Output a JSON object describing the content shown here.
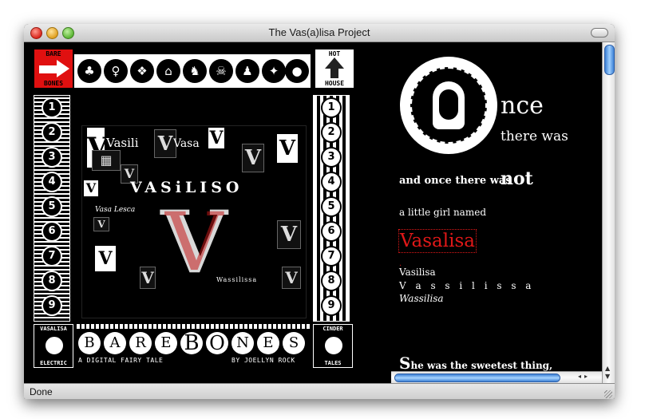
{
  "window": {
    "title": "The Vas(a)lisa Project",
    "status": "Done"
  },
  "frame": {
    "corner_top_left": {
      "top": "BARE",
      "bottom": "BONES"
    },
    "corner_top_right": {
      "top": "HOT",
      "bottom": "HOUSE"
    },
    "numbers_left": [
      "1",
      "2",
      "3",
      "4",
      "5",
      "6",
      "7",
      "8",
      "9"
    ],
    "numbers_right": [
      "1",
      "2",
      "3",
      "4",
      "5",
      "6",
      "7",
      "8",
      "9"
    ],
    "collage": {
      "words": [
        "Vasili",
        "Vasa",
        "VASiLISO",
        "Vasa Lesca",
        "Wassilissa"
      ],
      "letter": "V"
    },
    "bottom_left": {
      "top": "VASALISA",
      "bottom": "ELECTRIC"
    },
    "bottom_right": {
      "top": "CINDER",
      "bottom": "TALES"
    },
    "title_letters": [
      "B",
      "A",
      "R",
      "E",
      "B",
      "O",
      "N",
      "E",
      "S"
    ],
    "subtitle_left": "A DIGITAL FAIRY TALE",
    "subtitle_right": "BY JOELLYN ROCK"
  },
  "story": {
    "once": "nce",
    "there_was": "there was",
    "and_once": "and once there was",
    "not": "not",
    "little_girl": "a little girl named",
    "name_main": "Vasalisa",
    "name_variants": [
      "Vasilisa",
      "V a s s i l i s s a",
      "Wassilisa"
    ],
    "sweetest_cap": "S",
    "sweetest": "he was the sweetest thing,"
  }
}
